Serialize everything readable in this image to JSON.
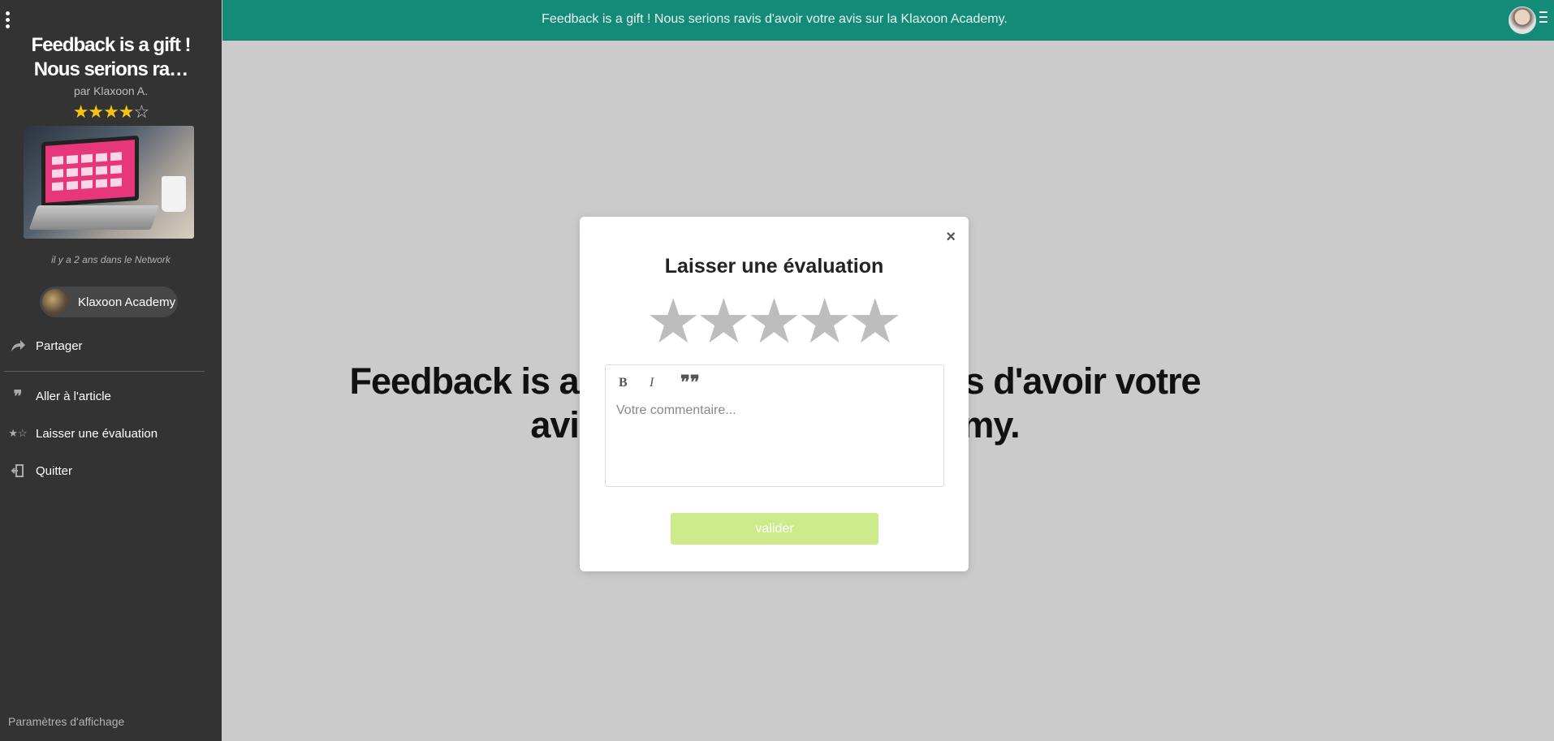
{
  "sidebar": {
    "title_line1": "Feedback is a gift !",
    "title_line2": "Nous serions ra…",
    "author": "par Klaxoon A.",
    "rating_filled": "★★★★",
    "rating_empty": "☆",
    "meta": "il y a 2 ans dans le Network",
    "network_chip": "Klaxoon Academy",
    "menu": [
      {
        "label": "Partager",
        "icon": "share-icon"
      },
      {
        "label": "Aller à l'article",
        "icon": "quote-icon"
      },
      {
        "label": "Laisser une évaluation",
        "icon": "rating-stars-icon"
      },
      {
        "label": "Quitter",
        "icon": "exit-icon"
      }
    ],
    "settings": "Paramètres d'affichage"
  },
  "topbar": {
    "text": "Feedback is a gift ! Nous serions ravis d'avoir votre avis sur la Klaxoon Academy."
  },
  "background": {
    "headline_line1": "Feedback is a gift ! Nous serions ravis d'avoir votre",
    "headline_line2": "avis sur la Klaxoon Academy."
  },
  "modal": {
    "close": "×",
    "title": "Laisser une évaluation",
    "stars": [
      "★",
      "★",
      "★",
      "★",
      "★"
    ],
    "toolbar": {
      "bold": "B",
      "italic": "I",
      "quote": "❞❞"
    },
    "comment_placeholder": "Votre commentaire...",
    "submit": "valider"
  },
  "colors": {
    "topbar": "#148b78",
    "sidebar": "#333333",
    "submit": "#cdeb8b",
    "star_gold": "#f5c40f"
  }
}
